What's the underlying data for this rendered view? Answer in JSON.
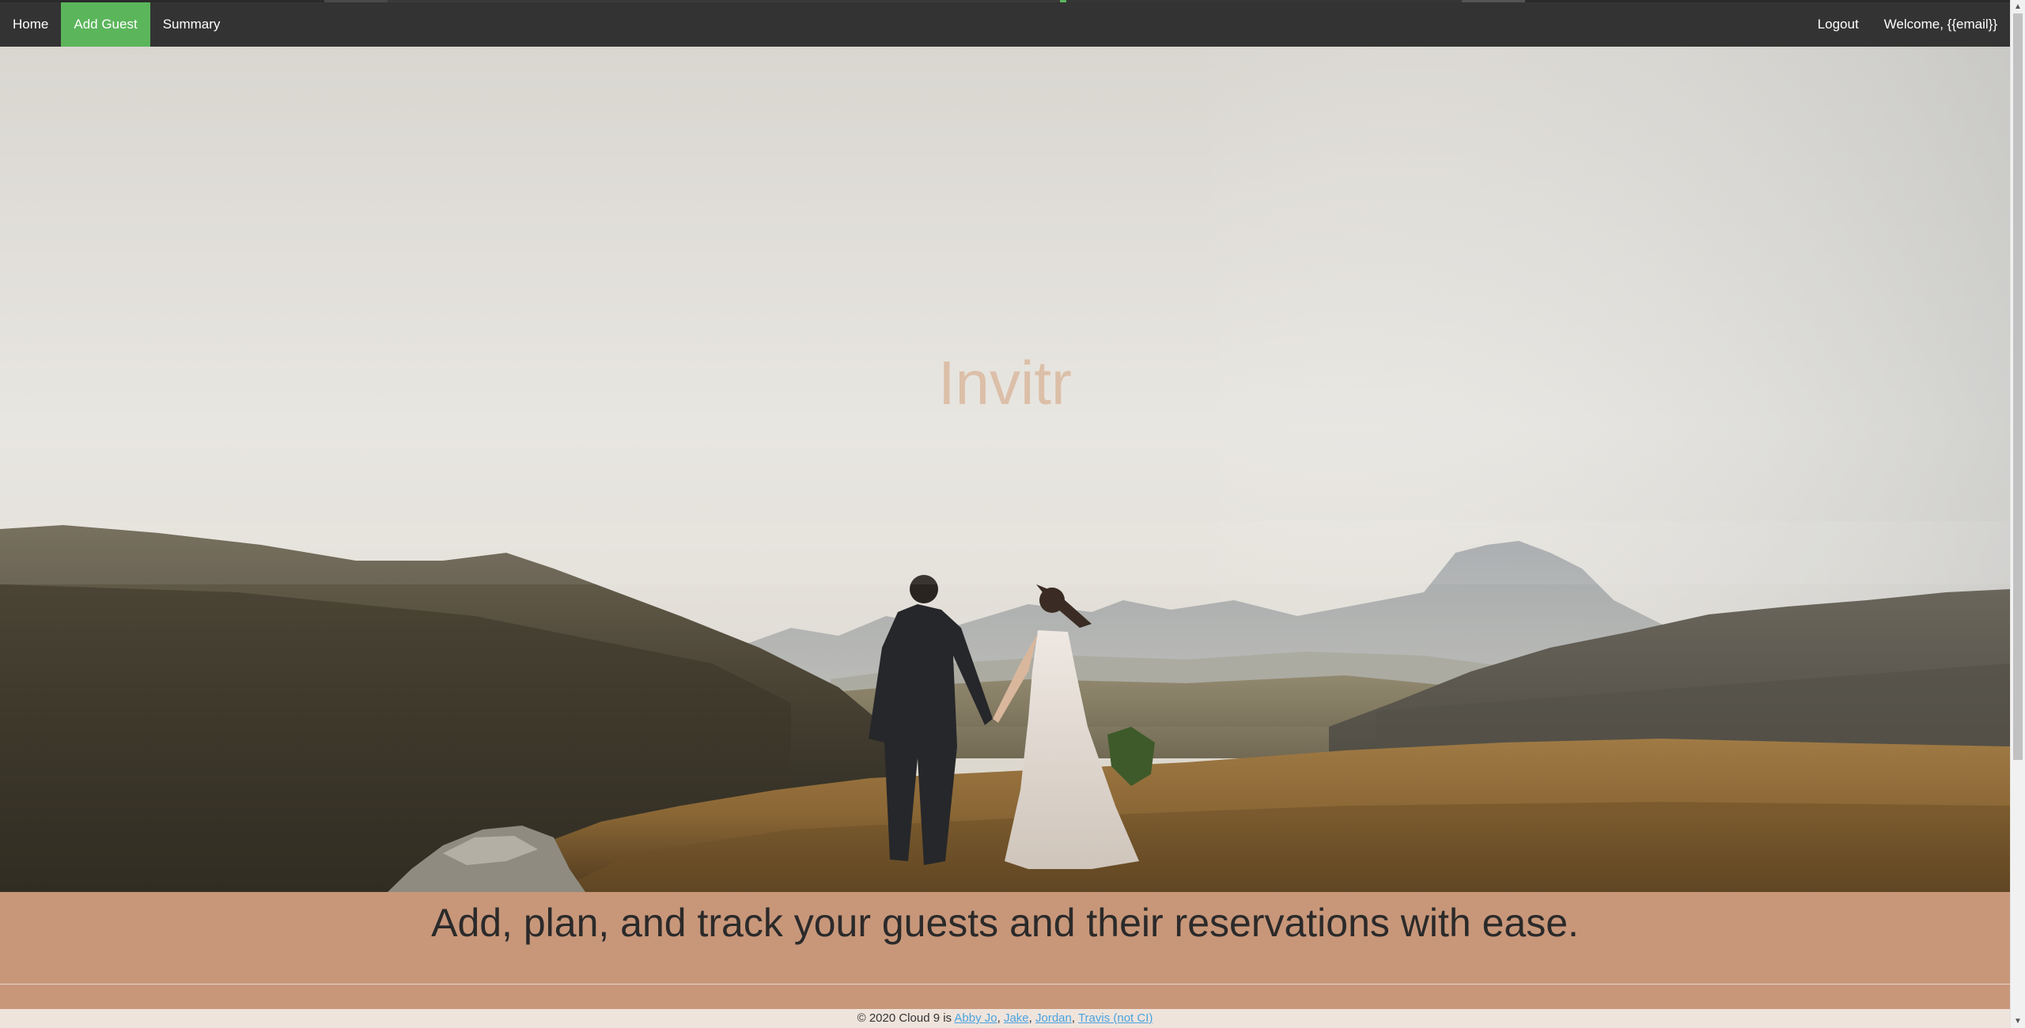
{
  "nav": {
    "home_label": "Home",
    "add_guest_label": "Add Guest",
    "summary_label": "Summary",
    "logout_label": "Logout",
    "welcome_label": "Welcome, {{email}}",
    "active_color": "#5bb55b",
    "bar_color": "#333333"
  },
  "hero": {
    "title": "Invitr",
    "title_color": "#dcbfa8"
  },
  "tagline": {
    "text": "Add, plan, and track your guests and their reservations with ease.",
    "band_color": "#c8977a"
  },
  "footer": {
    "prefix": "© 2020 Cloud 9 is ",
    "authors": [
      "Abby Jo",
      "Jake",
      "Jordan",
      "Travis (not CI)"
    ],
    "sep1": ", ",
    "sep2": ", ",
    "sep3": ", "
  },
  "scrollbar": {
    "up_icon": "▲",
    "down_icon": "▼"
  }
}
